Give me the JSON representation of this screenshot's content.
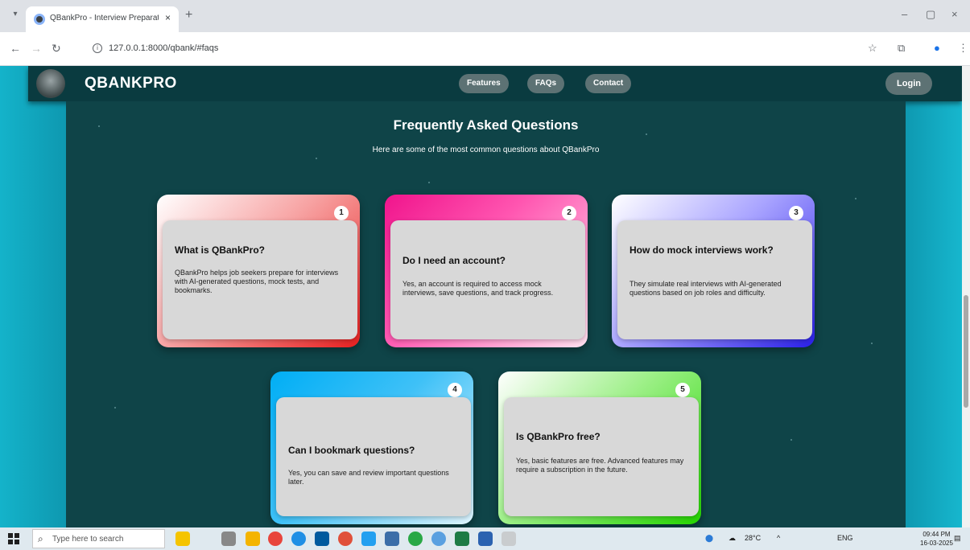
{
  "browser": {
    "tab_title": "QBankPro - Interview Preparat...",
    "tab_close": "×",
    "new_tab": "+",
    "url": "127.0.0.1:8000/qbank/#faqs",
    "window_controls": [
      "–",
      "▢",
      "×"
    ]
  },
  "header": {
    "brand": "QBANKPRO",
    "nav": [
      "Features",
      "FAQs",
      "Contact"
    ],
    "login": "Login"
  },
  "faq": {
    "title": "Frequently Asked Questions",
    "subtitle": "Here are some of the most common questions about QBankPro",
    "items": [
      {
        "num": "1",
        "question": "What is QBankPro?",
        "answer": "QBankPro helps job seekers prepare for interviews with AI-generated questions, mock tests, and bookmarks."
      },
      {
        "num": "2",
        "question": "Do I need an account?",
        "answer": "Yes, an account is required to access mock interviews, save questions, and track progress."
      },
      {
        "num": "3",
        "question": "How do mock interviews work?",
        "answer": "They simulate real interviews with AI-generated questions based on job roles and difficulty."
      },
      {
        "num": "4",
        "question": "Can I bookmark questions?",
        "answer": "Yes, you can save and review important questions later."
      },
      {
        "num": "5",
        "question": "Is QBankPro free?",
        "answer": "Yes, basic features are free. Advanced features may require a subscription in the future."
      }
    ]
  },
  "taskbar": {
    "search_placeholder": "Type here to search",
    "weather": "28°C",
    "language": "ENG",
    "time": "09:44 PM",
    "date": "16-03-2025"
  },
  "colors": {
    "page_bg": "#0f4448",
    "header_bg": "#0a3b40",
    "side_cyan": "#18b8cf",
    "pill": "#5d7274"
  }
}
